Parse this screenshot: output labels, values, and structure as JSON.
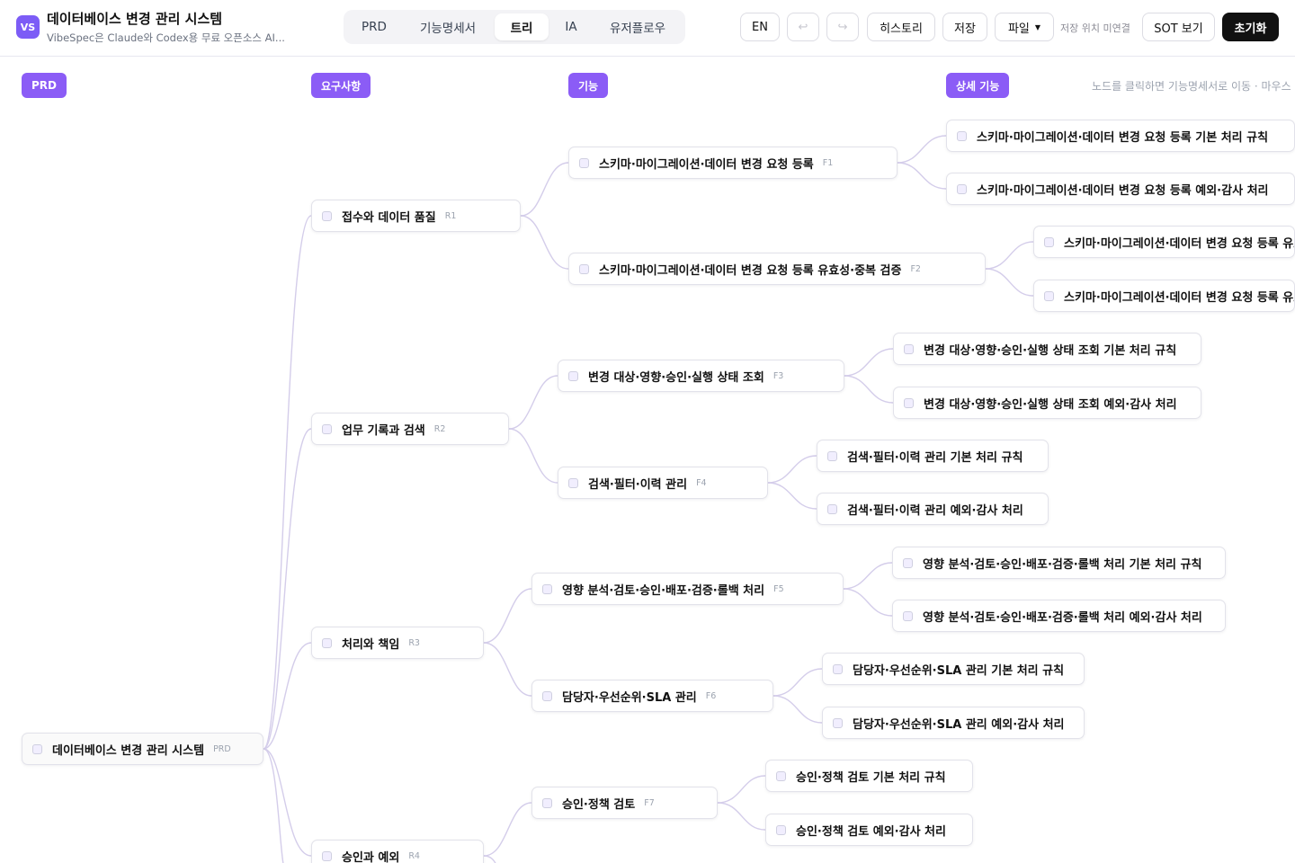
{
  "header": {
    "logo": "VS",
    "title": "데이터베이스 변경 관리 시스템",
    "subtitle": "VibeSpec은 Claude와 Codex용 무료 오픈소스 AI...",
    "tabs": [
      "PRD",
      "기능명세서",
      "트리",
      "IA",
      "유저플로우"
    ],
    "active_tab": "트리",
    "lang": "EN",
    "undo_icon": "undo-icon",
    "redo_icon": "redo-icon",
    "history": "히스토리",
    "save": "저장",
    "file": "파일",
    "save_status": "저장 위치 미연결",
    "sot_view": "SOT 보기",
    "reset": "초기화"
  },
  "tree": {
    "columns": [
      "PRD",
      "요구사항",
      "기능",
      "상세 기능"
    ],
    "hint": "노드를 클릭하면 기능명세서로 이동 · 마우스",
    "root": {
      "label": "데이터베이스 변경 관리 시스템",
      "code": "PRD"
    },
    "requirements": [
      {
        "label": "접수와 데이터 품질",
        "code": "R1"
      },
      {
        "label": "업무 기록과 검색",
        "code": "R2"
      },
      {
        "label": "처리와 책임",
        "code": "R3"
      },
      {
        "label": "승인과 예외",
        "code": "R4"
      }
    ],
    "features": [
      {
        "label": "스키마·마이그레이션·데이터 변경 요청 등록",
        "code": "F1"
      },
      {
        "label": "스키마·마이그레이션·데이터 변경 요청 등록 유효성·중복 검증",
        "code": "F2"
      },
      {
        "label": "변경 대상·영향·승인·실행 상태 조회",
        "code": "F3"
      },
      {
        "label": "검색·필터·이력 관리",
        "code": "F4"
      },
      {
        "label": "영향 분석·검토·승인·배포·검증·롤백 처리",
        "code": "F5"
      },
      {
        "label": "담당자·우선순위·SLA 관리",
        "code": "F6"
      },
      {
        "label": "승인·정책 검토",
        "code": "F7"
      }
    ],
    "details": [
      "스키마·마이그레이션·데이터 변경 요청 등록 기본 처리 규칙",
      "스키마·마이그레이션·데이터 변경 요청 등록 예외·감사 처리",
      "스키마·마이그레이션·데이터 변경 요청 등록 유효성·중복 검증 기본 처리 규칙",
      "스키마·마이그레이션·데이터 변경 요청 등록 유효성·중복 검증 예외·감사 처리",
      "변경 대상·영향·승인·실행 상태 조회 기본 처리 규칙",
      "변경 대상·영향·승인·실행 상태 조회 예외·감사 처리",
      "검색·필터·이력 관리 기본 처리 규칙",
      "검색·필터·이력 관리 예외·감사 처리",
      "영향 분석·검토·승인·배포·검증·롤백 처리 기본 처리 규칙",
      "영향 분석·검토·승인·배포·검증·롤백 처리 예외·감사 처리",
      "담당자·우선순위·SLA 관리 기본 처리 규칙",
      "담당자·우선순위·SLA 관리 예외·감사 처리",
      "승인·정책 검토 기본 처리 규칙",
      "승인·정책 검토 예외·감사 처리"
    ],
    "colors": {
      "accent": "#8b5cf6",
      "link": "#d4cdea"
    }
  }
}
